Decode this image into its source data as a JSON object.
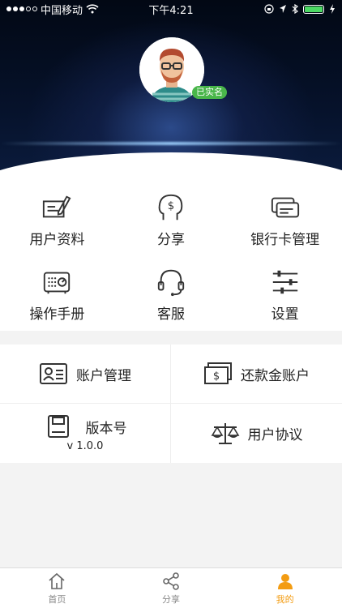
{
  "status_bar": {
    "carrier": "中国移动",
    "time": "下午4:21"
  },
  "profile": {
    "verified_badge": "已实名"
  },
  "grid": [
    {
      "label": "用户资料",
      "icon": "user-info-icon"
    },
    {
      "label": "分享",
      "icon": "share-head-icon"
    },
    {
      "label": "银行卡管理",
      "icon": "bank-card-icon"
    },
    {
      "label": "操作手册",
      "icon": "manual-icon"
    },
    {
      "label": "客服",
      "icon": "headset-icon"
    },
    {
      "label": "设置",
      "icon": "settings-sliders-icon"
    }
  ],
  "cards": {
    "account_manage": "账户管理",
    "repay_account": "还款金账户",
    "version_label": "版本号",
    "version_value": "v 1.0.0",
    "user_agreement": "用户协议"
  },
  "tabs": [
    {
      "label": "首页",
      "icon": "home-icon"
    },
    {
      "label": "分享",
      "icon": "share-icon"
    },
    {
      "label": "我的",
      "icon": "person-icon"
    }
  ],
  "colors": {
    "accent": "#f39c12",
    "badge": "#49b64a",
    "header_bg": "#06122b"
  }
}
